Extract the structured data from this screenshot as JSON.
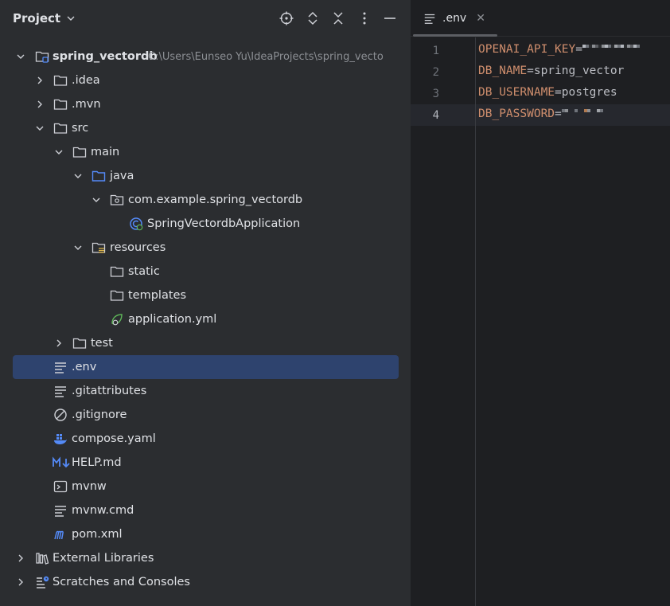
{
  "project_panel": {
    "title": "Project",
    "header_icons": [
      "locate-icon",
      "expand-all-icon",
      "collapse-all-icon",
      "more-options-icon",
      "minimize-icon"
    ]
  },
  "tree": [
    {
      "label": "spring_vectordb",
      "path": "C:\\Users\\Eunseo Yu\\IdeaProjects\\spring_vecto",
      "icon": "module-folder-icon",
      "expanded": true
    },
    {
      "label": ".idea",
      "icon": "folder-icon",
      "expanded": false
    },
    {
      "label": ".mvn",
      "icon": "folder-icon",
      "expanded": false
    },
    {
      "label": "src",
      "icon": "folder-icon",
      "expanded": true
    },
    {
      "label": "main",
      "icon": "folder-icon",
      "expanded": true
    },
    {
      "label": "java",
      "icon": "source-folder-icon",
      "expanded": true
    },
    {
      "label": "com.example.spring_vectordb",
      "icon": "package-icon",
      "expanded": true
    },
    {
      "label": "SpringVectordbApplication",
      "icon": "spring-boot-class-icon"
    },
    {
      "label": "resources",
      "icon": "resources-folder-icon",
      "expanded": true
    },
    {
      "label": "static",
      "icon": "folder-icon"
    },
    {
      "label": "templates",
      "icon": "folder-icon"
    },
    {
      "label": "application.yml",
      "icon": "spring-yaml-icon"
    },
    {
      "label": "test",
      "icon": "folder-icon",
      "expanded": false
    },
    {
      "label": ".env",
      "icon": "text-file-icon",
      "selected": true
    },
    {
      "label": ".gitattributes",
      "icon": "text-file-icon"
    },
    {
      "label": ".gitignore",
      "icon": "ignore-file-icon"
    },
    {
      "label": "compose.yaml",
      "icon": "docker-icon"
    },
    {
      "label": "HELP.md",
      "icon": "markdown-icon"
    },
    {
      "label": "mvnw",
      "icon": "shell-script-icon"
    },
    {
      "label": "mvnw.cmd",
      "icon": "text-file-icon"
    },
    {
      "label": "pom.xml",
      "icon": "maven-icon"
    },
    {
      "label": "External Libraries",
      "icon": "libraries-icon",
      "expanded": false
    },
    {
      "label": "Scratches and Consoles",
      "icon": "scratches-icon",
      "expanded": false
    }
  ],
  "editor": {
    "tab": {
      "label": ".env",
      "close": "✕"
    },
    "lines": [
      {
        "num": "1",
        "key": "OPENAI_API_KEY",
        "eq": "=",
        "value": "",
        "redacted": true
      },
      {
        "num": "2",
        "key": "DB_NAME",
        "eq": "=",
        "value": "spring_vector"
      },
      {
        "num": "3",
        "key": "DB_USERNAME",
        "eq": "=",
        "value": "postgres"
      },
      {
        "num": "4",
        "key": "DB_PASSWORD",
        "eq": "=",
        "value": "",
        "redacted": true,
        "current": true
      }
    ]
  },
  "colors": {
    "panel_bg": "#2b2d30",
    "editor_bg": "#1e1f22",
    "selection": "#2e436e",
    "key": "#cf8e6d",
    "folder_blue": "#548af7",
    "spring_green": "#5fb85a"
  }
}
